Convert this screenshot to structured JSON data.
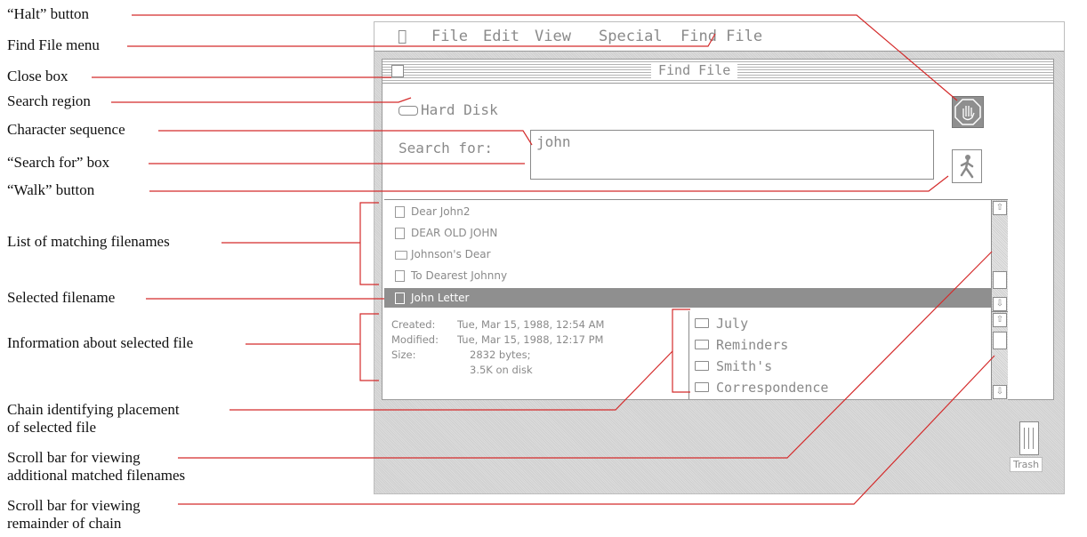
{
  "callouts": {
    "halt_button": "“Halt” button",
    "find_file_menu": "Find File menu",
    "close_box": "Close box",
    "search_region": "Search region",
    "character_sequence": "Character sequence",
    "search_for_box": "“Search for” box",
    "walk_button": "“Walk” button",
    "list_of_matching": "List of matching filenames",
    "selected_filename": "Selected filename",
    "information_about": "Information about selected file",
    "chain_line1": "Chain identifying placement",
    "chain_line2": "of selected file",
    "scroll_matched_line1": "Scroll bar for viewing",
    "scroll_matched_line2": "additional matched filenames",
    "scroll_chain_line1": "Scroll bar for viewing",
    "scroll_chain_line2": "remainder of chain"
  },
  "menubar": {
    "items": [
      "File",
      "Edit",
      "View",
      "Special",
      "Find File"
    ]
  },
  "window": {
    "title": "Find File",
    "search_region": "Hard Disk",
    "search_label": "Search for:",
    "search_value": "john",
    "files": [
      {
        "name": "Dear John2",
        "icon": "document-icon"
      },
      {
        "name": "DEAR OLD JOHN",
        "icon": "document-icon"
      },
      {
        "name": "Johnson's Dear",
        "icon": "folder-icon"
      },
      {
        "name": "To Dearest Johnny",
        "icon": "document-icon"
      },
      {
        "name": "John Letter",
        "icon": "document-icon"
      }
    ],
    "info": {
      "created_label": "Created:",
      "created_value": "Tue, Mar 15, 1988, 12:54 AM",
      "modified_label": "Modified:",
      "modified_value": "Tue, Mar 15, 1988, 12:17 PM",
      "size_label": "Size:",
      "size_value1": "2832 bytes;",
      "size_value2": "3.5K on disk"
    },
    "chain": [
      "July",
      "Reminders",
      "Smith's",
      "Correspondence"
    ]
  },
  "desktop": {
    "trash_label": "Trash"
  },
  "colors": {
    "leader_line": "#d42b2b",
    "selection": "#8f8f8f",
    "ui_gray": "#8a8a8a"
  }
}
